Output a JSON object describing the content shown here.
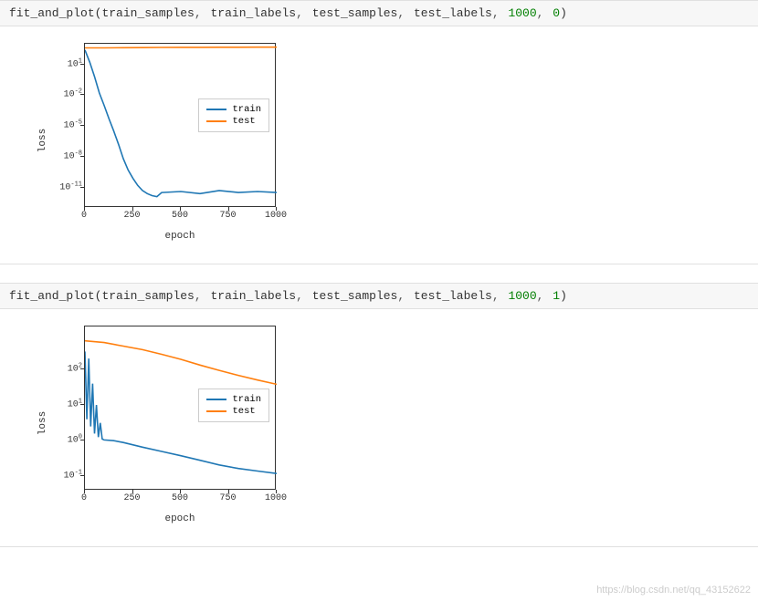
{
  "cells": [
    {
      "code": {
        "fn": "fit_and_plot",
        "args": [
          "train_samples",
          "train_labels",
          "test_samples",
          "test_labels"
        ],
        "nums": [
          "1000",
          "0"
        ]
      }
    },
    {
      "code": {
        "fn": "fit_and_plot",
        "args": [
          "train_samples",
          "train_labels",
          "test_samples",
          "test_labels"
        ],
        "nums": [
          "1000",
          "1"
        ]
      }
    }
  ],
  "legend": {
    "train": "train",
    "test": "test"
  },
  "axes": {
    "x": "epoch",
    "y": "loss"
  },
  "watermark": "https://blog.csdn.net/qq_43152622",
  "chart_data": [
    {
      "type": "line",
      "title": "",
      "xlabel": "epoch",
      "ylabel": "loss",
      "xlim": [
        0,
        1000
      ],
      "ylim_log10": [
        -13,
        3
      ],
      "yscale": "log",
      "x_ticks": [
        0,
        250,
        500,
        750,
        1000
      ],
      "y_ticks_exp": [
        1,
        -2,
        -5,
        -8,
        -11
      ],
      "legend_pos": "center-right",
      "series": [
        {
          "name": "train",
          "color": "#1f77b4",
          "x": [
            0,
            25,
            50,
            75,
            100,
            125,
            150,
            175,
            200,
            225,
            250,
            275,
            300,
            325,
            350,
            375,
            400,
            500,
            600,
            700,
            800,
            900,
            1000
          ],
          "y_log10": [
            2.4,
            1.2,
            -0.2,
            -1.8,
            -3.0,
            -4.3,
            -5.5,
            -6.8,
            -8.2,
            -9.3,
            -10.1,
            -10.8,
            -11.3,
            -11.6,
            -11.8,
            -11.9,
            -11.5,
            -11.4,
            -11.6,
            -11.3,
            -11.5,
            -11.4,
            -11.5
          ]
        },
        {
          "name": "test",
          "color": "#ff7f0e",
          "x": [
            0,
            100,
            200,
            300,
            400,
            500,
            600,
            700,
            800,
            900,
            1000
          ],
          "y_log10": [
            2.6,
            2.6,
            2.62,
            2.63,
            2.64,
            2.65,
            2.65,
            2.66,
            2.66,
            2.67,
            2.67
          ]
        }
      ]
    },
    {
      "type": "line",
      "title": "",
      "xlabel": "epoch",
      "ylabel": "loss",
      "xlim": [
        0,
        1000
      ],
      "ylim_log10": [
        -1.4,
        3.2
      ],
      "yscale": "log",
      "x_ticks": [
        0,
        250,
        500,
        750,
        1000
      ],
      "y_ticks_exp": [
        2,
        1,
        0,
        -1
      ],
      "legend_pos": "center-right",
      "series": [
        {
          "name": "train",
          "color": "#1f77b4",
          "x": [
            0,
            10,
            20,
            30,
            40,
            50,
            60,
            70,
            80,
            90,
            100,
            150,
            200,
            300,
            400,
            500,
            600,
            700,
            800,
            900,
            1000
          ],
          "y_log10": [
            2.5,
            0.6,
            2.3,
            0.4,
            1.6,
            0.2,
            1.0,
            0.1,
            0.5,
            0.05,
            0.02,
            0.0,
            -0.05,
            -0.18,
            -0.3,
            -0.42,
            -0.55,
            -0.68,
            -0.78,
            -0.85,
            -0.92
          ]
        },
        {
          "name": "test",
          "color": "#ff7f0e",
          "x": [
            0,
            100,
            200,
            300,
            400,
            500,
            600,
            700,
            800,
            900,
            1000
          ],
          "y_log10": [
            2.8,
            2.75,
            2.65,
            2.55,
            2.42,
            2.28,
            2.12,
            1.97,
            1.83,
            1.7,
            1.58
          ]
        }
      ]
    }
  ]
}
